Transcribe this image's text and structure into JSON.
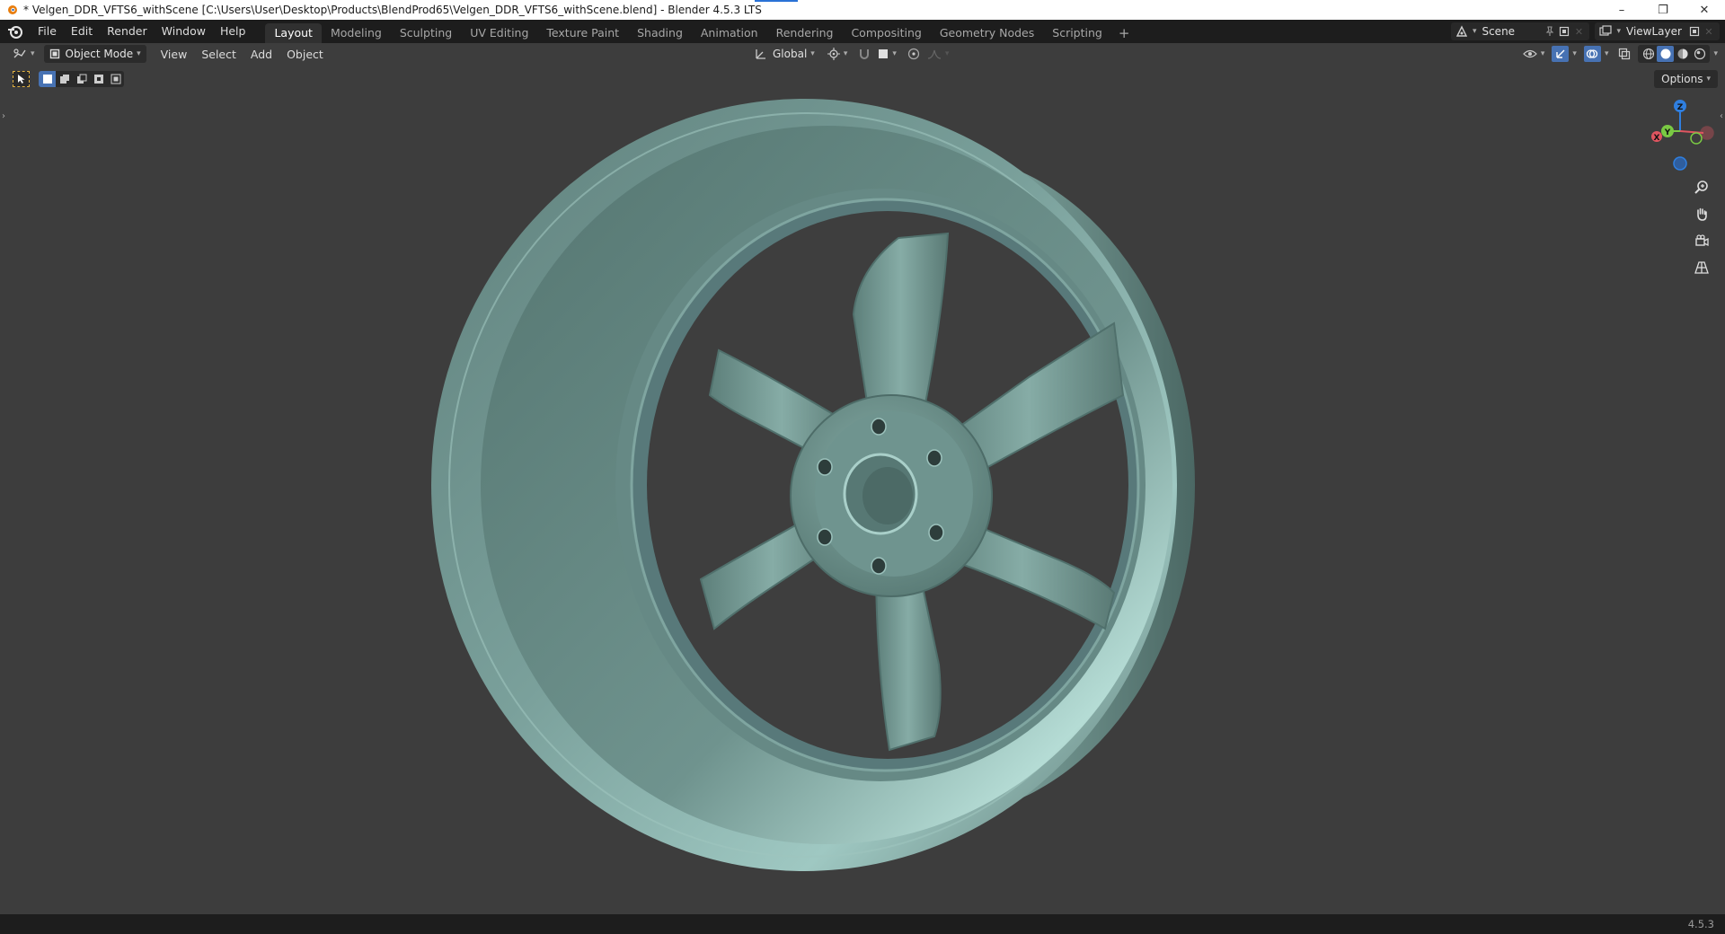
{
  "window": {
    "title": "* Velgen_DDR_VFTS6_withScene [C:\\Users\\User\\Desktop\\Products\\BlendProd65\\Velgen_DDR_VFTS6_withScene.blend] - Blender 4.5.3 LTS",
    "controls": {
      "minimize": "–",
      "restore": "❐",
      "close": "✕"
    }
  },
  "menubar": {
    "items": [
      "File",
      "Edit",
      "Render",
      "Window",
      "Help"
    ]
  },
  "workspaces": {
    "tabs": [
      "Layout",
      "Modeling",
      "Sculpting",
      "UV Editing",
      "Texture Paint",
      "Shading",
      "Animation",
      "Rendering",
      "Compositing",
      "Geometry Nodes",
      "Scripting"
    ],
    "active": "Layout",
    "add_label": "+"
  },
  "scene": {
    "name": "Scene"
  },
  "view_layer": {
    "name": "ViewLayer"
  },
  "viewport_header": {
    "mode": "Object Mode",
    "menus": [
      "View",
      "Select",
      "Add",
      "Object"
    ],
    "orientation": "Global"
  },
  "tool_settings": {
    "options_label": "Options"
  },
  "gizmo": {
    "x": "X",
    "y": "Y",
    "z": "Z"
  },
  "colors": {
    "accent": "#4772b3",
    "background": "#3d3d3d",
    "header": "#1d1d1d",
    "wheel_base": "#6a8e89",
    "x_axis": "#e05560",
    "y_axis": "#7ac943",
    "z_axis": "#2f7fe0"
  },
  "statusbar": {
    "version": "4.5.3"
  }
}
